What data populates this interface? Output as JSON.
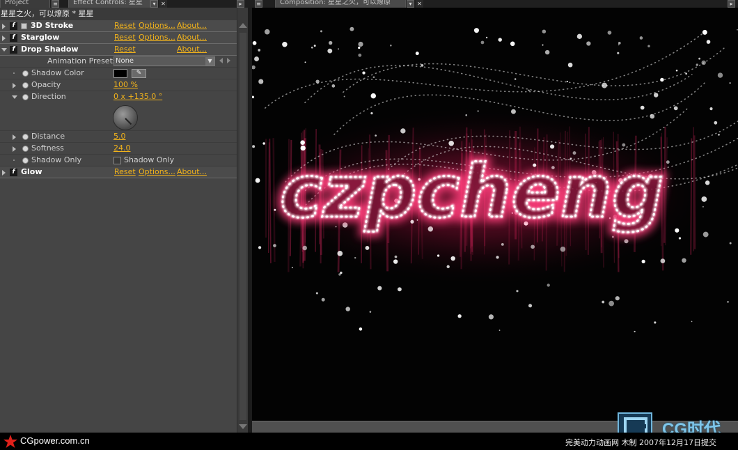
{
  "tabs": {
    "project": "Project",
    "effect_controls": "Effect Controls: 星星",
    "composition": "Composition: 星星之火，可以燎原"
  },
  "effect_panel": {
    "comp_label": "星星之火，可以燎原 * 星星",
    "link_reset": "Reset",
    "link_options": "Options...",
    "link_about": "About...",
    "effects": [
      {
        "name": "3D Stroke",
        "links": [
          "Reset",
          "Options...",
          "About..."
        ]
      },
      {
        "name": "Starglow",
        "links": [
          "Reset",
          "Options...",
          "About..."
        ]
      },
      {
        "name": "Drop Shadow",
        "links": [
          "Reset",
          "About..."
        ]
      },
      {
        "name": "Glow",
        "links": [
          "Reset",
          "Options...",
          "About..."
        ]
      }
    ],
    "animation_presets": {
      "label": "Animation Presets:",
      "value": "None"
    },
    "properties": {
      "shadow_color": {
        "label": "Shadow Color",
        "color": "#000000"
      },
      "opacity": {
        "label": "Opacity",
        "value": "100 %"
      },
      "direction": {
        "label": "Direction",
        "value": "0 x +135.0 °"
      },
      "distance": {
        "label": "Distance",
        "value": "5.0"
      },
      "softness": {
        "label": "Softness",
        "value": "24.0"
      },
      "shadow_only": {
        "label": "Shadow Only",
        "checkbox_label": "Shadow Only",
        "checked": false
      }
    }
  },
  "viewer": {
    "artwork_text": "czpcheng",
    "glow_color": "#ff2d6e",
    "star_color": "#ffffff"
  },
  "footer": {
    "site": "CGpower.com.cn",
    "credit": "完美动力动画网 木制 2007年12月17日提交",
    "badge": "CG时代"
  },
  "colors": {
    "link_yellow": "#f2b31b",
    "panel_bg": "#454545",
    "viewer_bg": "#030303"
  }
}
